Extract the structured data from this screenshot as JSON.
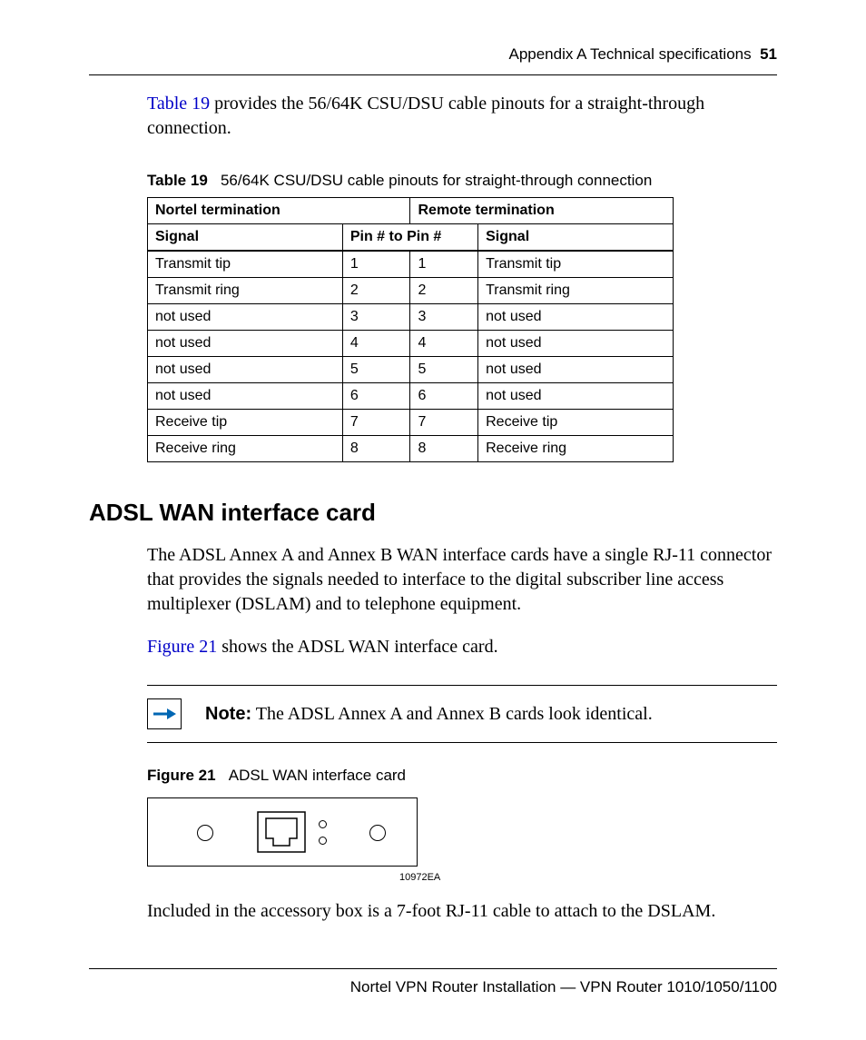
{
  "header": {
    "section": "Appendix A  Technical specifications",
    "page": "51"
  },
  "intro": {
    "link": "Table 19",
    "rest": " provides the 56/64K CSU/DSU cable pinouts for a straight-through connection."
  },
  "table": {
    "label": "Table 19",
    "caption": "56/64K CSU/DSU cable pinouts for straight-through connection",
    "grp_left": "Nortel termination",
    "grp_right": "Remote termination",
    "hdr_signal": "Signal",
    "hdr_pinL": "Pin #",
    "hdr_to": "to",
    "hdr_pinR": "Pin #",
    "rows": [
      {
        "sL": "Transmit tip",
        "pL": "1",
        "pR": "1",
        "sR": "Transmit tip"
      },
      {
        "sL": "Transmit ring",
        "pL": "2",
        "pR": "2",
        "sR": "Transmit ring"
      },
      {
        "sL": "not used",
        "pL": "3",
        "pR": "3",
        "sR": "not used"
      },
      {
        "sL": "not used",
        "pL": "4",
        "pR": "4",
        "sR": "not used"
      },
      {
        "sL": "not used",
        "pL": "5",
        "pR": "5",
        "sR": "not used"
      },
      {
        "sL": "not used",
        "pL": "6",
        "pR": "6",
        "sR": "not used"
      },
      {
        "sL": "Receive tip",
        "pL": "7",
        "pR": "7",
        "sR": "Receive tip"
      },
      {
        "sL": "Receive ring",
        "pL": "8",
        "pR": "8",
        "sR": "Receive ring"
      }
    ]
  },
  "section_title": "ADSL WAN interface card",
  "adsl_para": "The ADSL Annex A and Annex B WAN interface cards have a single RJ-11 connector that provides the signals needed to interface to the digital subscriber line access multiplexer (DSLAM) and to telephone equipment.",
  "fig_intro": {
    "link": "Figure 21",
    "rest": " shows the ADSL WAN interface card."
  },
  "note": {
    "label": "Note:",
    "text": " The ADSL Annex A and Annex B cards look identical."
  },
  "figure": {
    "label": "Figure 21",
    "caption": "ADSL WAN interface card",
    "code": "10972EA"
  },
  "closing": "Included in the accessory box is a 7-foot RJ-11 cable to attach to the DSLAM.",
  "footer": "Nortel VPN Router Installation — VPN Router 1010/1050/1100"
}
